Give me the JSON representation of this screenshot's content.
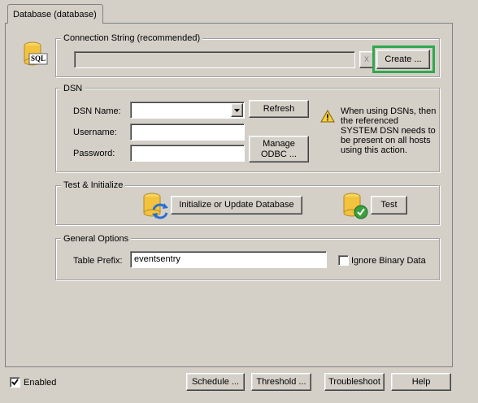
{
  "tab": {
    "label": "Database (database)"
  },
  "connection": {
    "legend": "Connection String (recommended)",
    "value": "",
    "clear_label": "X",
    "create_label": "Create ..."
  },
  "dsn": {
    "legend": "DSN",
    "name_label": "DSN Name:",
    "username_label": "Username:",
    "password_label": "Password:",
    "refresh_label": "Refresh",
    "manage_line1": "Manage",
    "manage_line2": "ODBC ...",
    "warning_text": "When using DSNs, then the referenced SYSTEM DSN needs to be present on all hosts using this action."
  },
  "test": {
    "legend": "Test & Initialize",
    "init_label": "Initialize or Update Database",
    "test_label": "Test"
  },
  "general": {
    "legend": "General Options",
    "prefix_label": "Table Prefix:",
    "prefix_value": "eventsentry",
    "ignore_binary_label": "Ignore Binary Data",
    "ignore_binary_checked": false
  },
  "footer": {
    "enabled_label": "Enabled",
    "enabled_checked": true,
    "schedule_label": "Schedule ...",
    "threshold_label": "Threshold ...",
    "troubleshoot_label": "Troubleshoot",
    "help_label": "Help"
  },
  "sql_icon_text": "SQL",
  "colors": {
    "highlight": "#2fa84f"
  }
}
